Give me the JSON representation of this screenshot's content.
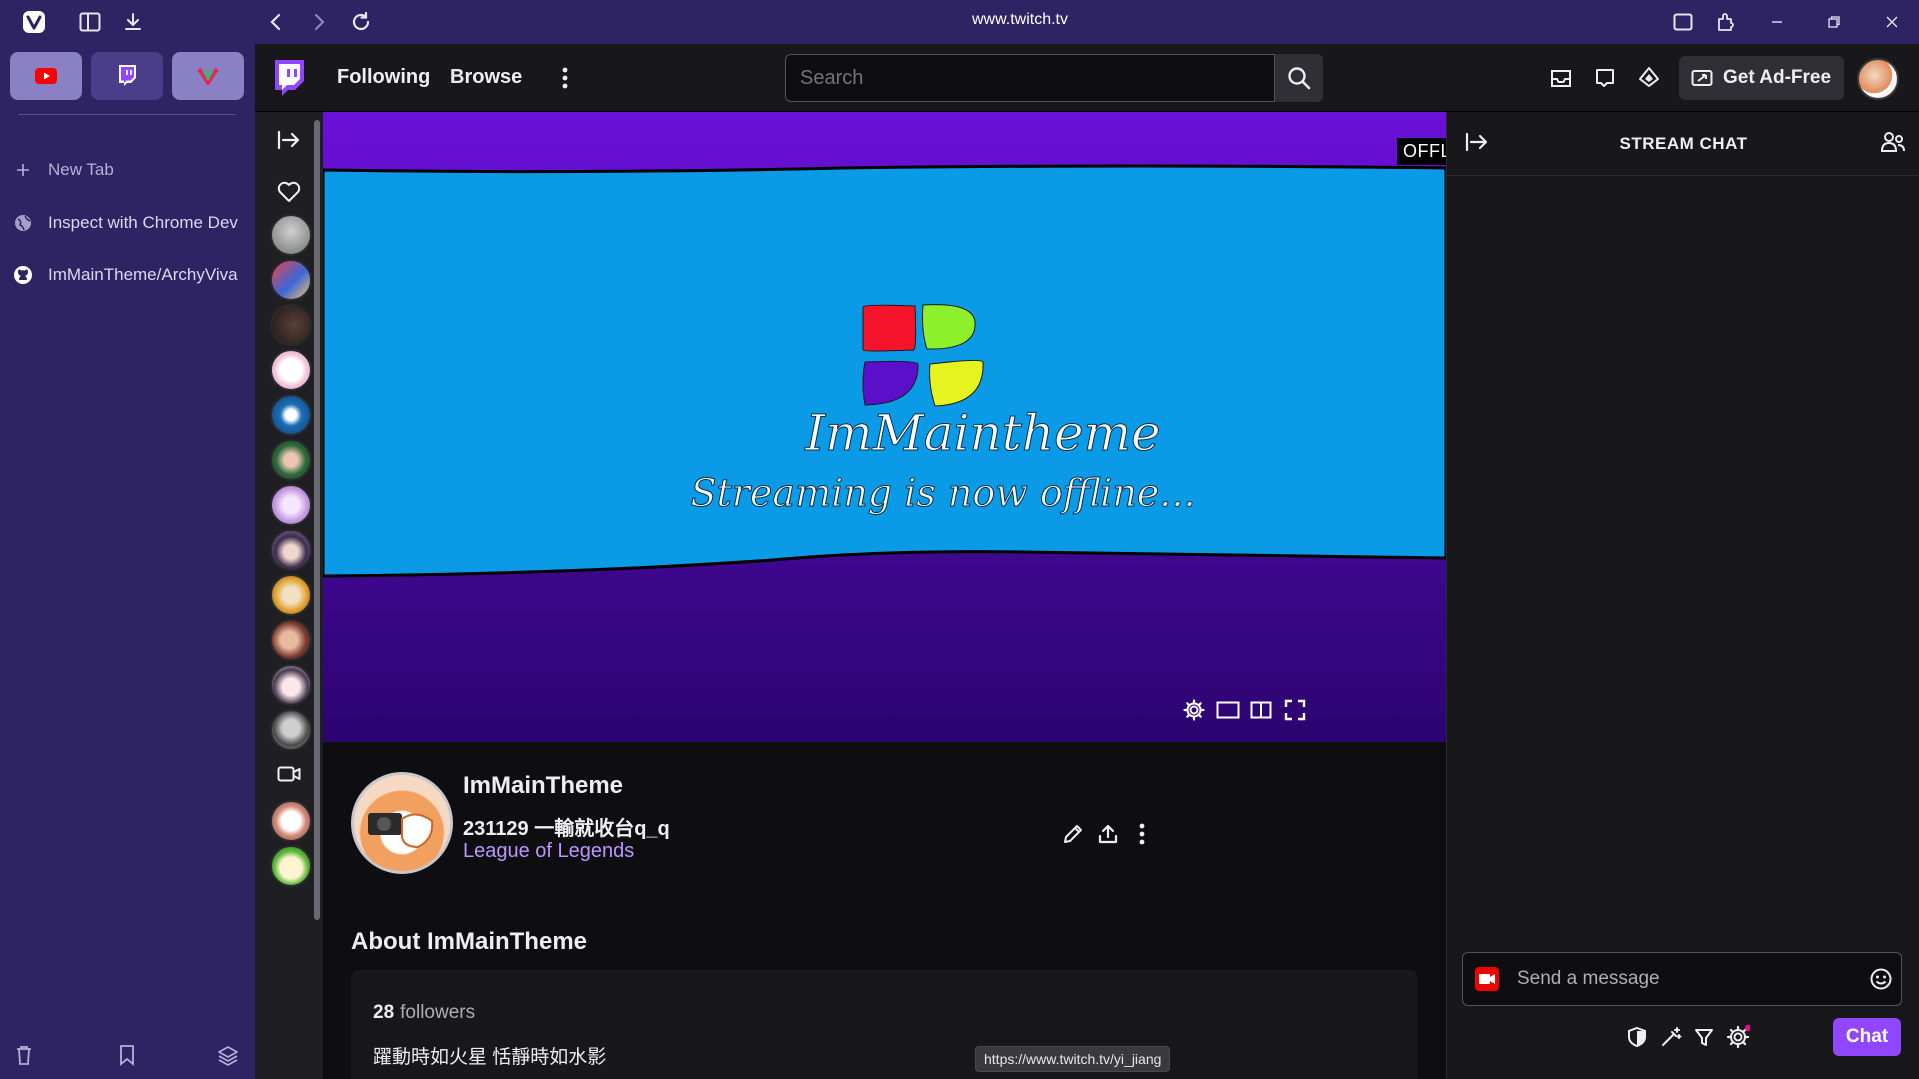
{
  "browser": {
    "url": "www.twitch.tv",
    "pinned_tabs": [
      "YouTube",
      "Twitch",
      "Vivaldi"
    ],
    "new_tab_label": "New Tab",
    "tabs": [
      {
        "label": "Inspect with Chrome Dev",
        "icon": "globe-icon"
      },
      {
        "label": "ImMainTheme/ArchyViva",
        "icon": "github-icon"
      }
    ],
    "colors": {
      "panel": "#2e2363",
      "youtube": "#ff0000",
      "twitch": "#9146ff"
    }
  },
  "twitch": {
    "nav": {
      "following": "Following",
      "browse": "Browse",
      "search_placeholder": "Search",
      "get_ad_free": "Get Ad-Free"
    },
    "player": {
      "offline_badge": "OFFLINE",
      "logo_text": "ImMaintheme",
      "offline_message": "Streaming is now offline...",
      "logo_colors": [
        "#f3142c",
        "#8ef02a",
        "#5a0fc8",
        "#e6f31e"
      ],
      "screen_color": "#0a9ae6"
    },
    "channel": {
      "name": "ImMainTheme",
      "stream_title": "231129 一輸就收台q_q",
      "game": "League of Legends",
      "about_heading": "About ImMainTheme",
      "followers_count": "28",
      "followers_label": "followers",
      "bio": "躍動時如火星 恬靜時如水影"
    },
    "status_url": "https://www.twitch.tv/yi_jiang",
    "chat": {
      "title": "STREAM CHAT",
      "placeholder": "Send a message",
      "chat_button": "Chat"
    },
    "accent": "#9147ff"
  }
}
